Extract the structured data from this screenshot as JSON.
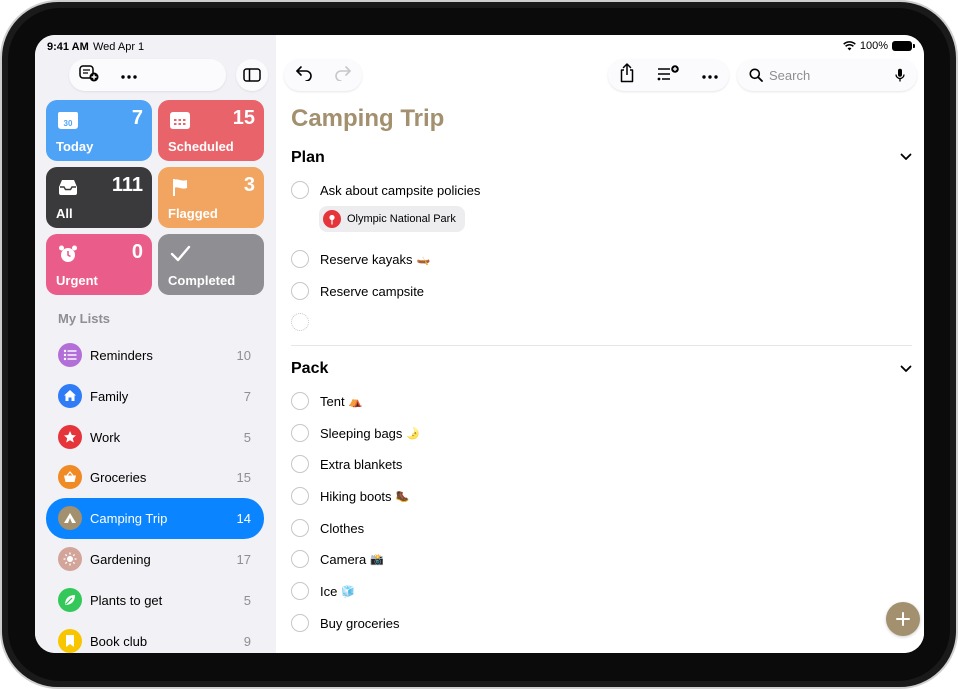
{
  "status_bar": {
    "time": "9:41 AM",
    "date": "Wed Apr 1",
    "battery": "100%"
  },
  "colors": {
    "accent": "#a2906e",
    "selected": "#0a84ff"
  },
  "smart_lists": [
    {
      "label": "Today",
      "count": "7",
      "icon": "calendar-today-icon",
      "color": "#4fa3f7"
    },
    {
      "label": "Scheduled",
      "count": "15",
      "icon": "calendar-icon",
      "color": "#e9636a"
    },
    {
      "label": "All",
      "count": "111",
      "icon": "tray-icon",
      "color": "#3a3a3c"
    },
    {
      "label": "Flagged",
      "count": "3",
      "icon": "flag-icon",
      "color": "#f1a561"
    },
    {
      "label": "Urgent",
      "count": "0",
      "icon": "alarm-icon",
      "color": "#ea5d8a"
    },
    {
      "label": "Completed",
      "count": "",
      "icon": "checkmark-icon",
      "color": "#8e8e93"
    }
  ],
  "my_lists_title": "My Lists",
  "lists": [
    {
      "name": "Reminders",
      "count": "10",
      "icon": "list-icon",
      "color": "#b36fd8"
    },
    {
      "name": "Family",
      "count": "7",
      "icon": "house-icon",
      "color": "#2f7cf6"
    },
    {
      "name": "Work",
      "count": "5",
      "icon": "star-icon",
      "color": "#e5343a"
    },
    {
      "name": "Groceries",
      "count": "15",
      "icon": "basket-icon",
      "color": "#f08a24"
    },
    {
      "name": "Camping Trip",
      "count": "14",
      "icon": "tent-icon",
      "color": "#a2906e",
      "selected": true
    },
    {
      "name": "Gardening",
      "count": "17",
      "icon": "sun-icon",
      "color": "#d3a49a"
    },
    {
      "name": "Plants to get",
      "count": "5",
      "icon": "leaf-icon",
      "color": "#34c759"
    },
    {
      "name": "Book club",
      "count": "9",
      "icon": "bookmark-icon",
      "color": "#f7c600"
    }
  ],
  "search": {
    "placeholder": "Search"
  },
  "list_title": "Camping Trip",
  "sections": [
    {
      "title": "Plan",
      "items": [
        {
          "text": "Ask about campsite policies",
          "location": "Olympic National Park"
        },
        {
          "text": "Reserve kayaks",
          "emoji": "🛶"
        },
        {
          "text": "Reserve campsite"
        }
      ]
    },
    {
      "title": "Pack",
      "items": [
        {
          "text": "Tent",
          "emoji": "⛺"
        },
        {
          "text": "Sleeping bags",
          "emoji": "🌛"
        },
        {
          "text": "Extra blankets"
        },
        {
          "text": "Hiking boots",
          "emoji": "🥾"
        },
        {
          "text": "Clothes"
        },
        {
          "text": "Camera",
          "emoji": "📸"
        },
        {
          "text": "Ice",
          "emoji": "🧊"
        },
        {
          "text": "Buy groceries"
        }
      ]
    }
  ]
}
